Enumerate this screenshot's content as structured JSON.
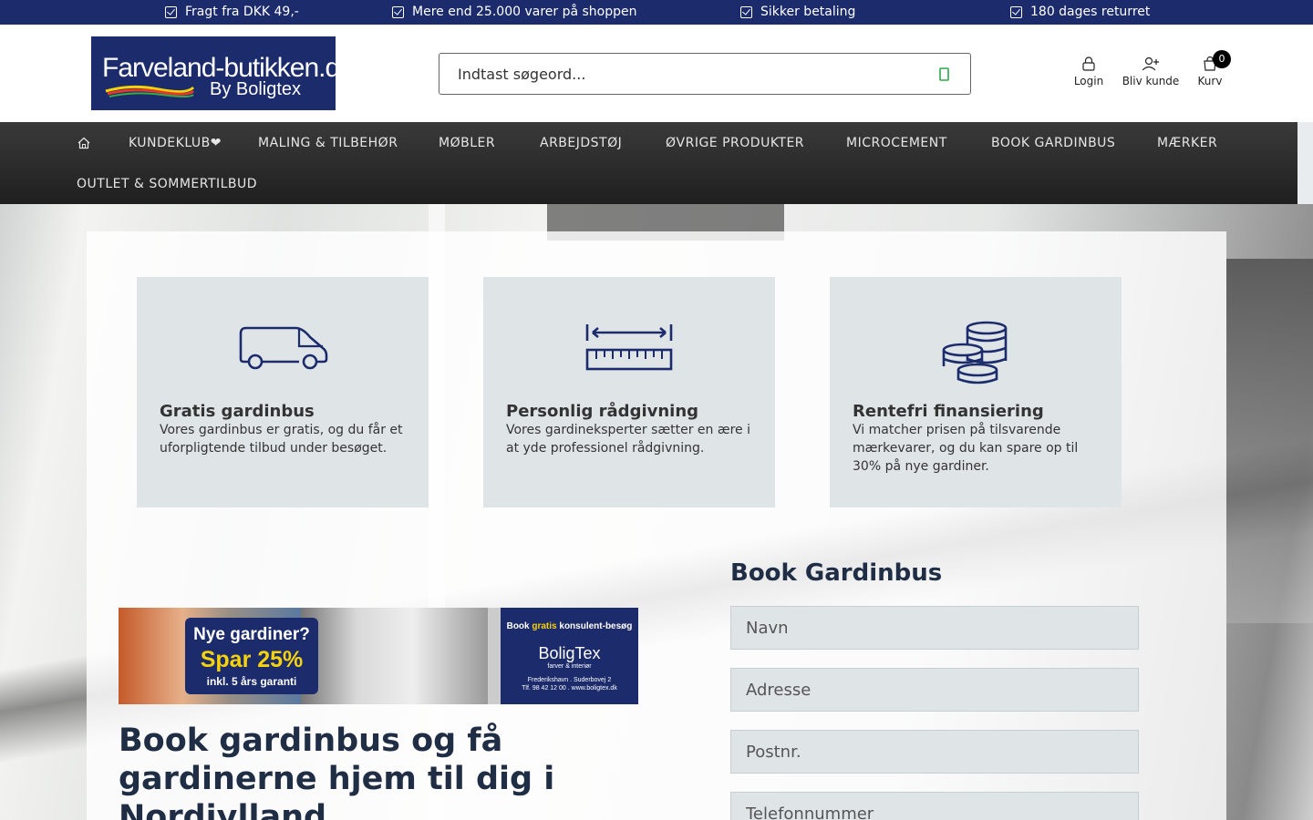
{
  "usps": [
    "Fragt fra DKK 49,-",
    "Mere end 25.000 varer på shoppen",
    "Sikker betaling",
    "180 dages returret"
  ],
  "logo": {
    "main": "Farveland-butikken.dk",
    "sub": "By Boligtex"
  },
  "search": {
    "placeholder": "Indtast søgeord..."
  },
  "header_links": {
    "login": "Login",
    "register": "Bliv kunde",
    "cart": "Kurv",
    "cart_count": "0"
  },
  "nav": [
    "KUNDEKLUB❤",
    "MALING & TILBEHØR",
    "MØBLER",
    "ARBEJDSTØJ",
    "ØVRIGE PRODUKTER",
    "MICROCEMENT",
    "BOOK GARDINBUS",
    "MÆRKER",
    "OUTLET & SOMMERTILBUD"
  ],
  "cards": [
    {
      "icon": "van-icon",
      "title": "Gratis gardinbus",
      "text": "Vores gardinbus er gratis, og du får et uforpligtende tilbud under besøget."
    },
    {
      "icon": "ruler-icon",
      "title": "Personlig rådgivning",
      "text": "Vores gardineksperter sætter en ære i at yde professionel rådgivning."
    },
    {
      "icon": "coins-icon",
      "title": "Rentefri finansiering",
      "text": "Vi matcher prisen på tilsvarende mærkevarer, og du kan spare op til 30% på nye gardiner."
    }
  ],
  "banner": {
    "line1": "Nye gardiner?",
    "line2": "Spar 25%",
    "line3": "inkl. 5 års garanti",
    "book_prefix": "Book ",
    "book_highlight": "gratis",
    "book_suffix": " konsulent-besøg",
    "brand": "BoligTex",
    "brand_sub": "farver & interiør",
    "address": "Frederikshavn . Suderbovej 2",
    "phone": "Tlf. 98 42 12 00 . www.boligtex.dk"
  },
  "main_title": "Book gardinbus og få gardinerne hjem til dig i Nordjylland",
  "form": {
    "title": "Book Gardinbus",
    "fields": [
      "Navn",
      "Adresse",
      "Postnr.",
      "Telefonnummer"
    ]
  },
  "colors": {
    "brand_blue": "#1b2b6b",
    "card_bg": "#dfe5e7",
    "nav_bg": "#2a2a2a",
    "yellow": "#f5d20a"
  }
}
